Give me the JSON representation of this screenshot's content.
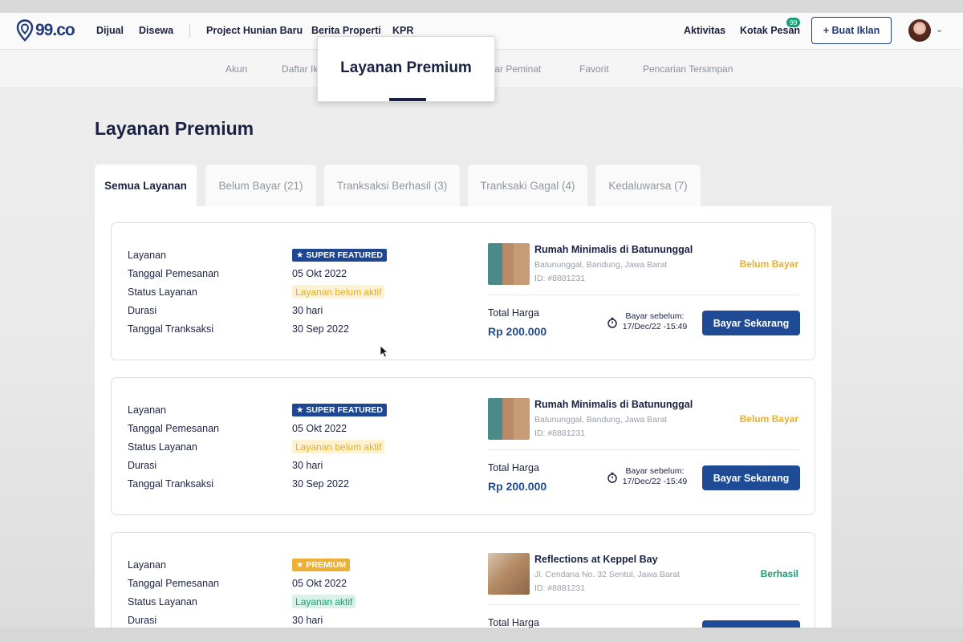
{
  "header": {
    "logo_text": "99.co",
    "nav": [
      "Dijual",
      "Disewa",
      "Project Hunian Baru",
      "Berita Properti",
      "KPR"
    ],
    "activity": "Aktivitas",
    "inbox": "Kotak Pesan",
    "inbox_badge": "99",
    "create_listing": "+ Buat Iklan"
  },
  "subnav": {
    "items": [
      "Akun",
      "Daftar Iklan",
      "tar Peminat",
      "Favorit",
      "Pencarian Tersimpan"
    ],
    "highlight": "Layanan Premium"
  },
  "page_title": "Layanan Premium",
  "tabs": [
    "Semua Layanan",
    "Belum Bayar (21)",
    "Tranksaksi Berhasil (3)",
    "Tranksaki Gagal (4)",
    "Kedaluwarsa (7)"
  ],
  "field_labels": {
    "service": "Layanan",
    "order_date": "Tanggal Pemesanan",
    "service_status": "Status Layanan",
    "duration": "Durasi",
    "transaction_date": "Tanggal Tranksaksi",
    "total_price": "Total Harga",
    "pay_before": "Bayar sebelum:"
  },
  "orders": [
    {
      "package": "SUPER FEATURED",
      "order_date": "05 Okt 2022",
      "service_status": "Layanan belum aktif",
      "duration": "30 hari",
      "transaction_date": "30 Sep 2022",
      "property_name": "Rumah Minimalis di Batununggal",
      "property_address": "Batununggal, Bandung, Jawa Barat",
      "property_id": "ID: #8881231",
      "payment_state": "Belum Bayar",
      "total": "Rp 200.000",
      "deadline": "17/Dec/22 -15:49",
      "pay_label": "Bayar Sekarang"
    },
    {
      "package": "SUPER FEATURED",
      "order_date": "05 Okt 2022",
      "service_status": "Layanan belum aktif",
      "duration": "30 hari",
      "transaction_date": "30 Sep 2022",
      "property_name": "Rumah Minimalis di Batununggal",
      "property_address": "Batununggal, Bandung, Jawa Barat",
      "property_id": "ID: #8881231",
      "payment_state": "Belum Bayar",
      "total": "Rp 200.000",
      "deadline": "17/Dec/22 -15:49",
      "pay_label": "Bayar Sekarang"
    },
    {
      "package": "PREMIUM",
      "order_date": "05 Okt 2022",
      "service_status": "Layanan aktif",
      "duration": "30 hari",
      "property_name": "Reflections at Keppel Bay",
      "property_address": "Jl. Cendana No. 32 Sentul, Jawa Barat",
      "property_id": "ID: #8881231",
      "payment_state": "Berhasil"
    }
  ],
  "colors": {
    "brand": "#1f3a78",
    "primary_button": "#1f4b96",
    "pending": "#e6b02e",
    "success": "#1a9b73"
  }
}
